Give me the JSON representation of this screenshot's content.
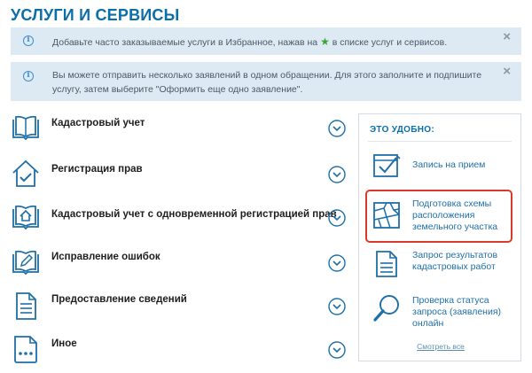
{
  "page": {
    "title": "УСЛУГИ И СЕРВИСЫ"
  },
  "notices": [
    {
      "text_before": "Добавьте часто заказываемые услуги в Избранное, нажав на",
      "text_after": "в списке услуг и сервисов.",
      "star_icon": "star-icon",
      "close": "×"
    },
    {
      "text": "Вы можете отправить несколько заявлений в одном обращении. Для этого заполните и подпишите услугу, затем выберите \"Оформить еще одно заявление\".",
      "close": "×"
    }
  ],
  "services": [
    {
      "label": "Кадастровый учет",
      "icon": "open-book-icon"
    },
    {
      "label": "Регистрация прав",
      "icon": "house-check-icon"
    },
    {
      "label": "Кадастровый учет с одновременной регистрацией прав",
      "icon": "book-house-icon"
    },
    {
      "label": "Исправление ошибок",
      "icon": "book-pencil-icon"
    },
    {
      "label": "Предоставление сведений",
      "icon": "document-icon"
    },
    {
      "label": "Иное",
      "icon": "file-dots-icon"
    }
  ],
  "sidebar": {
    "title": "ЭТО УДОБНО:",
    "items": [
      {
        "label": "Запись на прием",
        "icon": "calendar-check-icon"
      },
      {
        "label": "Подготовка схемы расположения земельного участка",
        "icon": "land-scheme-icon"
      },
      {
        "label": "Запрос результатов кадастровых работ",
        "icon": "document-request-icon"
      },
      {
        "label": "Проверка статуса запроса (заявления) онлайн",
        "icon": "magnifier-icon"
      }
    ],
    "see_all": "Смотреть все"
  },
  "colors": {
    "accent": "#0b6ea8",
    "notice_bg": "#dde9f3",
    "highlight": "#d93a2b",
    "star": "#3aa635"
  }
}
